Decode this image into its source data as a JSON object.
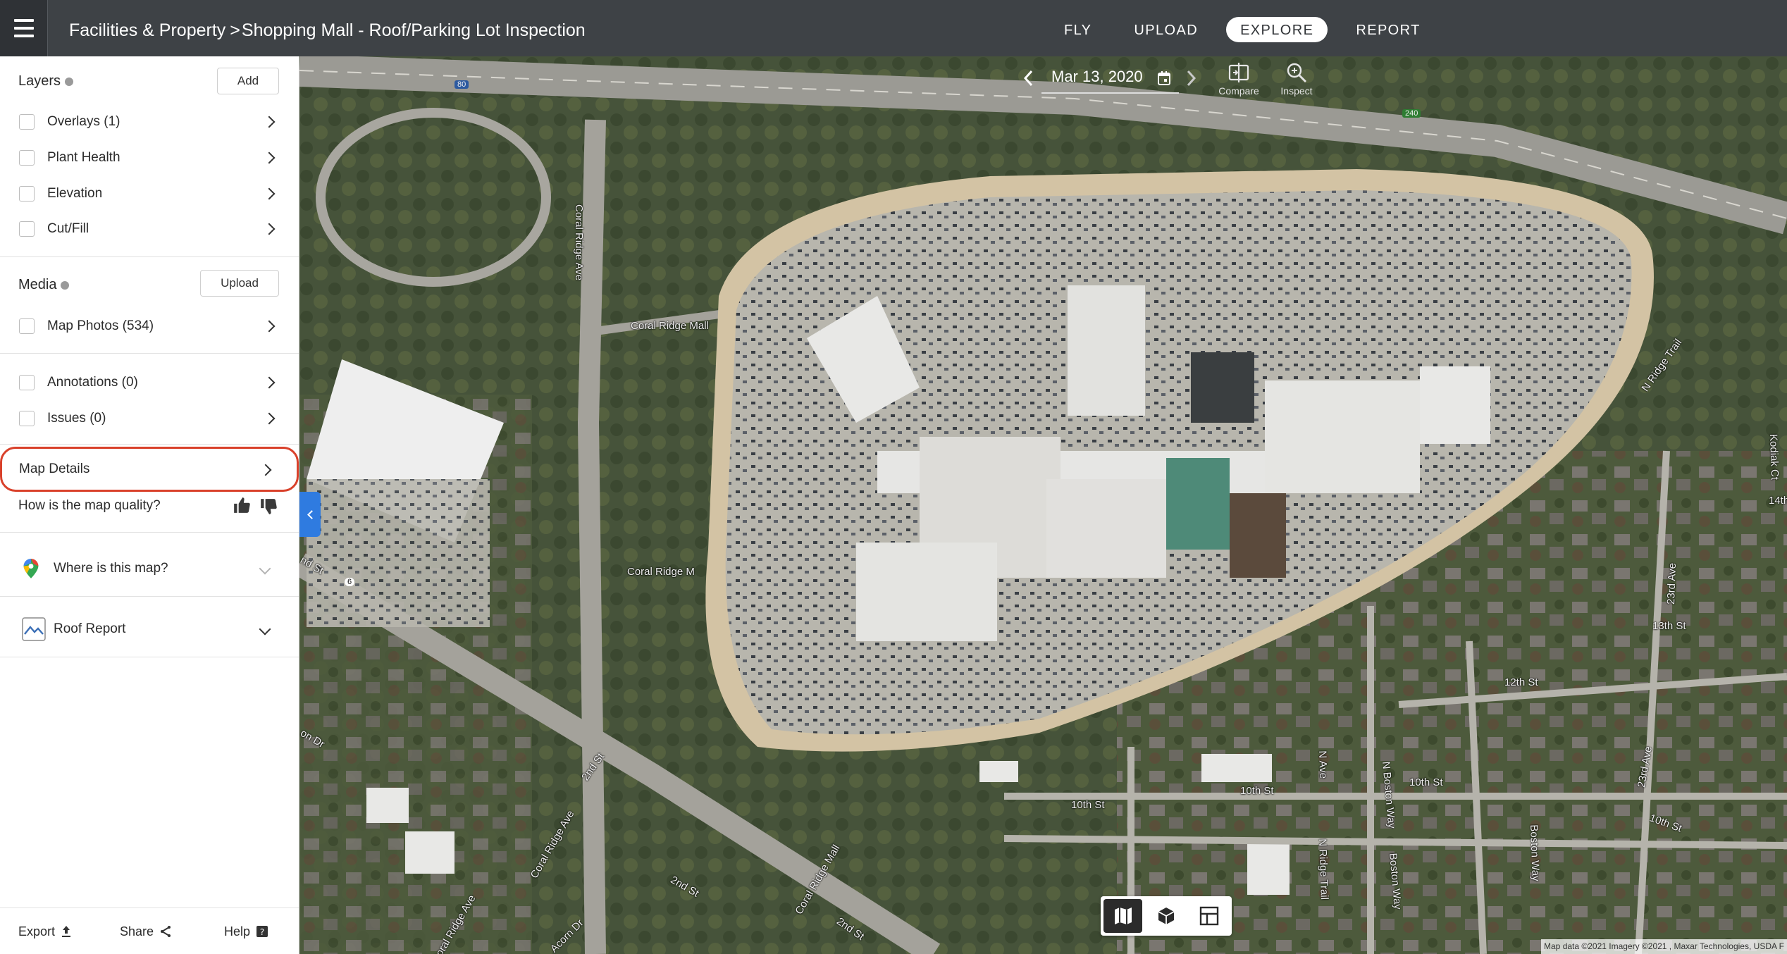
{
  "header": {
    "menu_icon": "hamburger-menu-icon",
    "breadcrumb_root": "Facilities & Property",
    "breadcrumb_separator": ">",
    "breadcrumb_current": "Shopping Mall - Roof/Parking Lot Inspection",
    "nav": [
      {
        "label": "FLY",
        "active": false
      },
      {
        "label": "UPLOAD",
        "active": false
      },
      {
        "label": "EXPLORE",
        "active": true
      },
      {
        "label": "REPORT",
        "active": false
      }
    ]
  },
  "sidebar": {
    "layers": {
      "title": "Layers",
      "add_label": "Add",
      "items": [
        {
          "label": "Overlays (1)",
          "checked": false
        },
        {
          "label": "Plant Health",
          "checked": false
        },
        {
          "label": "Elevation",
          "checked": false
        },
        {
          "label": "Cut/Fill",
          "checked": false
        }
      ]
    },
    "media": {
      "title": "Media",
      "upload_label": "Upload",
      "items": [
        {
          "label": "Map Photos (534)",
          "checked": false
        }
      ]
    },
    "annotations": [
      {
        "label": "Annotations (0)",
        "checked": false
      },
      {
        "label": "Issues (0)",
        "checked": false
      }
    ],
    "map_details_label": "Map Details",
    "quality_prompt": "How is the map quality?",
    "where_label": "Where is this map?",
    "roof_report_label": "Roof Report",
    "footer": {
      "export_label": "Export",
      "share_label": "Share",
      "help_label": "Help"
    }
  },
  "map": {
    "date": "Mar 13, 2020",
    "compare_label": "Compare",
    "inspect_label": "Inspect",
    "attribution": "Map data ©2021 Imagery ©2021 , Maxar Technologies, USDA F",
    "view_modes": [
      "2d-map-icon",
      "3d-model-icon",
      "split-view-icon"
    ],
    "streets": {
      "coral_ridge_ave_1": "Coral Ridge Ave",
      "coral_ridge_mall_1": "Coral Ridge Mall",
      "coral_ridge_mall_2": "Coral Ridge M",
      "n_ridge_trail": "N Ridge Trail",
      "twenty_third_ave_1": "23rd Ave",
      "twenty_third_ave_2": "23rd Ave",
      "kodiak_ct": "Kodiak Ct",
      "thirteenth_st": "13th St",
      "twelfth_st": "12th St",
      "tenth_st_1": "10th St",
      "tenth_st_2": "10th St",
      "tenth_st_3": "10th St",
      "tenth_st_4": "10th St",
      "n_boston_way": "N Boston Way",
      "boston_way_1": "Boston Way",
      "boston_way_2": "Boston Way",
      "n_ridge_trail_2": "N Ridge Trail",
      "second_st_1": "2nd St",
      "second_st_2": "2nd St",
      "second_st_3": "2nd St",
      "coral_ridge_ave_2": "Coral Ridge Ave",
      "coral_ridge_ave_3": "Coral Ridge Ave",
      "coral_ridge_mall_3": "Coral Ridge Mall",
      "acorn_dr": "Acorn Dr",
      "fourteenth_st": "14th",
      "n_ave": "N Ave",
      "nd_st_side": "nd St",
      "on_dr": "on Dr",
      "i80_shield": "80",
      "hwy6_shield": "6",
      "hwy240_shield": "240"
    }
  }
}
